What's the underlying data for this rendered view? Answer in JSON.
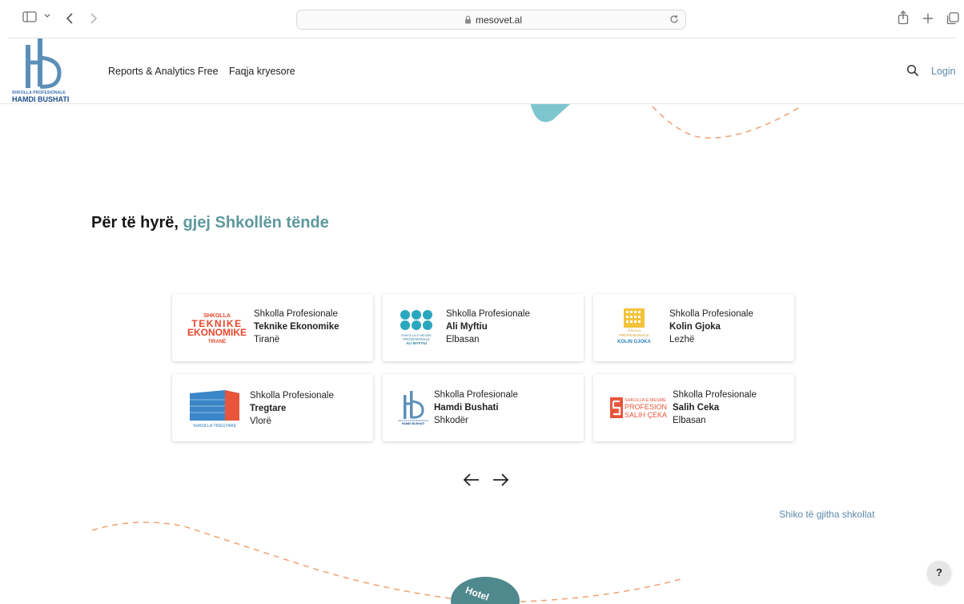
{
  "browser": {
    "url": "mesovet.al"
  },
  "header": {
    "logo_caption_top": "SHKOLLA PROFESIONALE",
    "logo_caption_bottom": "HAMDI BUSHATI",
    "nav": [
      "Reports & Analytics Free",
      "Faqja kryesore"
    ],
    "login_label": "Login"
  },
  "main": {
    "heading_prefix": "Për të hyrë,",
    "heading_accent": "gjej Shkollën tënde",
    "schools": [
      {
        "type": "Shkolla Profesionale",
        "name": "Teknike Ekonomike",
        "city": "Tiranë",
        "logo_lines": [
          "SHKOLLA",
          "TEKNIKE",
          "EKONOMIKE",
          "TIRANË"
        ]
      },
      {
        "type": "Shkolla Profesionale",
        "name": "Ali Myftiu",
        "city": "Elbasan",
        "logo_lines": [
          "SHKOLLA E MESME",
          "PROFESIONALE",
          "ALI MYFTIU"
        ]
      },
      {
        "type": "Shkolla Profesionale",
        "name": "Kolin Gjoka",
        "city": "Lezhë",
        "logo_lines": [
          "SHKOLLA",
          "PROFESIONALE",
          "KOLIN GJOKA"
        ]
      },
      {
        "type": "Shkolla Profesionale",
        "name": "Tregtare",
        "city": "Vlorë",
        "logo_lines": [
          "SHKOLLA TREGTARE"
        ]
      },
      {
        "type": "Shkolla Profesionale",
        "name": "Hamdi Bushati",
        "city": "Shkodër",
        "logo_lines": [
          "SHKOLLA PROFESIONALE",
          "HAMDI BUSHATI"
        ]
      },
      {
        "type": "Shkolla Profesionale",
        "name": "Salih Ceka",
        "city": "Elbasan",
        "logo_lines": [
          "SHKOLLA E MESME",
          "PROFESIONALE",
          "SALIH ÇEKA"
        ]
      }
    ],
    "see_all_label": "Shiko të gjitha shkollat",
    "hotel_blob_text": "Hotel",
    "help_label": "?"
  },
  "colors": {
    "accent": "#5d999f",
    "link": "#5d8aa8",
    "deco_dash": "#f0a070"
  }
}
